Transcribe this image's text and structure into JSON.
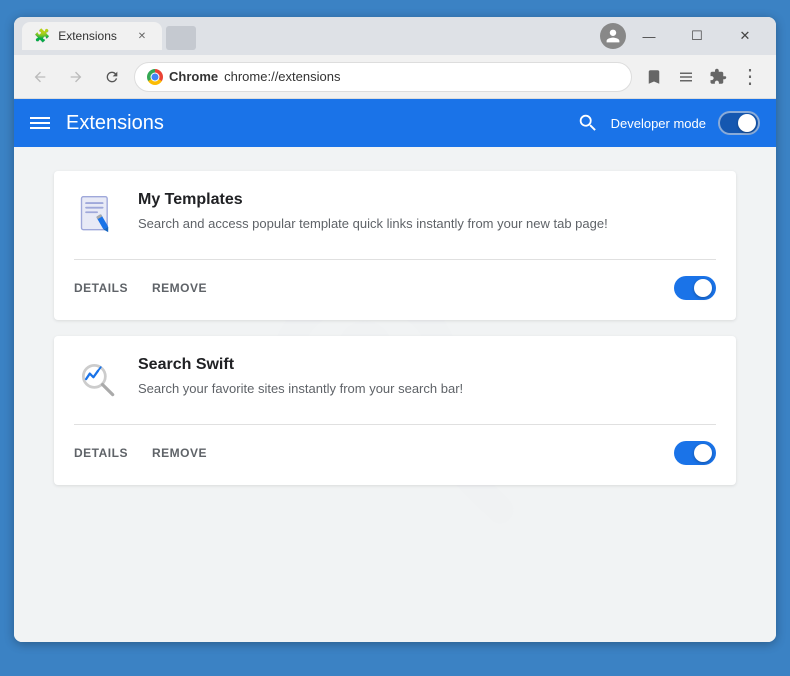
{
  "browser": {
    "tab_title": "Extensions",
    "tab_icon": "🧩",
    "address_bar": {
      "chrome_label": "Chrome",
      "url": "chrome://extensions"
    },
    "window_controls": {
      "minimize": "—",
      "maximize": "☐",
      "close": "✕"
    }
  },
  "extensions_page": {
    "header": {
      "title": "Extensions",
      "developer_mode_label": "Developer mode"
    },
    "extensions": [
      {
        "id": "my-templates",
        "name": "My Templates",
        "description": "Search and access popular template quick links instantly from your new tab page!",
        "details_btn": "DETAILS",
        "remove_btn": "REMOVE",
        "enabled": true
      },
      {
        "id": "search-swift",
        "name": "Search Swift",
        "description": "Search your favorite sites instantly from your search bar!",
        "details_btn": "DETAILS",
        "remove_btn": "REMOVE",
        "enabled": true
      }
    ]
  }
}
